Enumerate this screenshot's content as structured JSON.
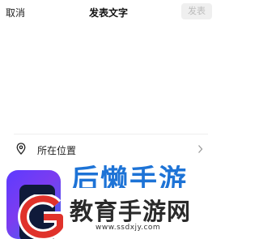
{
  "header": {
    "cancel_label": "取消",
    "title": "发表文字",
    "publish_label": "发表"
  },
  "location": {
    "label": "所在位置",
    "icon": "location-pin-icon",
    "chevron": "chevron-right-icon"
  },
  "watermark": {
    "top_text": "后懒手游",
    "brand_text": "教育手游网",
    "url": "www.ssdxjy.com"
  },
  "colors": {
    "publish_bg": "#efefef",
    "publish_text": "#bcbcbc",
    "watermark_blue": "#1d73d6",
    "watermark_red": "#e0322b"
  }
}
